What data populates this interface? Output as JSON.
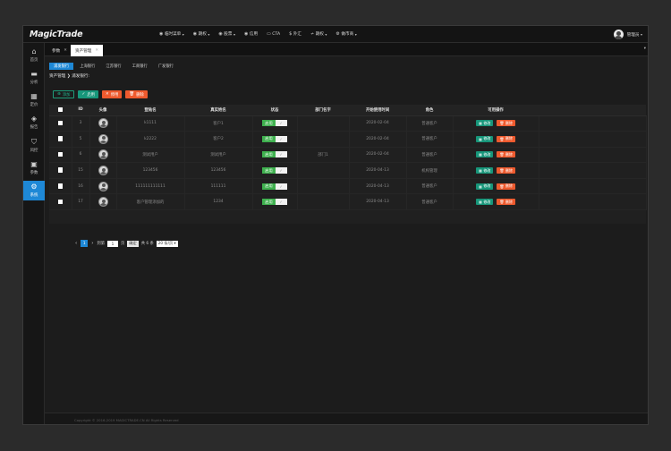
{
  "app": {
    "logo": "MagicTrade"
  },
  "topnav": [
    {
      "icon": "◉",
      "icon_name": "dot-icon",
      "label": "临时菜单",
      "caret": "▾"
    },
    {
      "icon": "◉",
      "icon_name": "dot-icon",
      "label": "期权",
      "caret": "▾"
    },
    {
      "icon": "◉",
      "icon_name": "dot-icon",
      "label": "股票",
      "caret": "▾"
    },
    {
      "icon": "◉",
      "icon_name": "dot-icon",
      "label": "信用",
      "caret": ""
    },
    {
      "icon": "▭",
      "icon_name": "folder-icon",
      "label": "CTA",
      "caret": ""
    },
    {
      "icon": "$",
      "icon_name": "dollar-icon",
      "label": "外汇",
      "caret": ""
    },
    {
      "icon": "≁",
      "icon_name": "futures-icon",
      "label": "期权",
      "caret": "▾"
    },
    {
      "icon": "⚙",
      "icon_name": "gear-icon",
      "label": "做市商",
      "caret": "▾"
    }
  ],
  "user": {
    "name": "管理员",
    "caret": "▾"
  },
  "sidebar": [
    {
      "icon": "⌂",
      "icon_name": "home-icon",
      "label": "首页",
      "active": false
    },
    {
      "icon": "▬",
      "icon_name": "chat-icon",
      "label": "分析",
      "active": false
    },
    {
      "icon": "▦",
      "icon_name": "calendar-icon",
      "label": "定价",
      "active": false
    },
    {
      "icon": "◈",
      "icon_name": "layers-icon",
      "label": "报告",
      "active": false
    },
    {
      "icon": "⛉",
      "icon_name": "shield-icon",
      "label": "风控",
      "active": false
    },
    {
      "icon": "▣",
      "icon_name": "grid-icon",
      "label": "参数",
      "active": false
    },
    {
      "icon": "⚙",
      "icon_name": "gear-icon",
      "label": "系统",
      "active": true
    }
  ],
  "page_tabs": [
    {
      "label": "参数",
      "close": "✕",
      "active": false
    },
    {
      "label": "资产管理",
      "close": "✕",
      "active": true
    }
  ],
  "tabs_dropdown": "▾",
  "subtabs": [
    "浦发银行",
    "上海银行",
    "江苏银行",
    "工商银行",
    "广发银行"
  ],
  "breadcrumb": "资产管理 ❯ 浦发银行:",
  "actions": {
    "add": {
      "icon": "⊕",
      "label": "添加"
    },
    "enable": {
      "icon": "✓",
      "label": "启用"
    },
    "disable": {
      "icon": "✕",
      "label": "停用"
    },
    "delete": {
      "icon": "🗑",
      "label": "删除"
    }
  },
  "table": {
    "headers": [
      "",
      "ID",
      "头像",
      "登陆名",
      "真实姓名",
      "状态",
      "部门名字",
      "开始使用时间",
      "角色",
      "可用操作"
    ],
    "rows": [
      {
        "id": "3",
        "login": "k1111",
        "realname": "客户1",
        "status": "启用",
        "dept": "",
        "start": "2020-02-04",
        "role": "普通客户"
      },
      {
        "id": "5",
        "login": "k2222",
        "realname": "客户2",
        "status": "启用",
        "dept": "",
        "start": "2020-02-04",
        "role": "普通客户"
      },
      {
        "id": "6",
        "login": "测试用户",
        "realname": "测试用户",
        "status": "启用",
        "dept": "部门1",
        "start": "2020-02-04",
        "role": "普通客户"
      },
      {
        "id": "15",
        "login": "123456",
        "realname": "123456",
        "status": "启用",
        "dept": "",
        "start": "2020-04-13",
        "role": "机构管理"
      },
      {
        "id": "16",
        "login": "111111111111",
        "realname": "111111",
        "status": "启用",
        "dept": "",
        "start": "2020-04-13",
        "role": "普通客户"
      },
      {
        "id": "17",
        "login": "客户管理添加的",
        "realname": "1234",
        "status": "启用",
        "dept": "",
        "start": "2020-04-13",
        "role": "普通客户"
      }
    ],
    "switch_off_mark": "✓",
    "edit_label": "修改",
    "delete_label": "删除",
    "edit_icon": "▦",
    "delete_icon": "🗑"
  },
  "pager": {
    "prev": "‹",
    "current": "1",
    "next": "›",
    "goto_label": "到第",
    "page_input": "1",
    "page_suffix": "页",
    "confirm": "确定",
    "total": "共 6 条",
    "page_size": "20 条/页 ▾"
  },
  "footer": {
    "copyright": "Copyright © 2016-2019 MAGICTRADE.CN All Rights Reserved"
  },
  "colors": {
    "accent": "#1e88d6",
    "green": "#17967a",
    "orange": "#ee5a2e",
    "switch_on": "#3fb14f"
  }
}
